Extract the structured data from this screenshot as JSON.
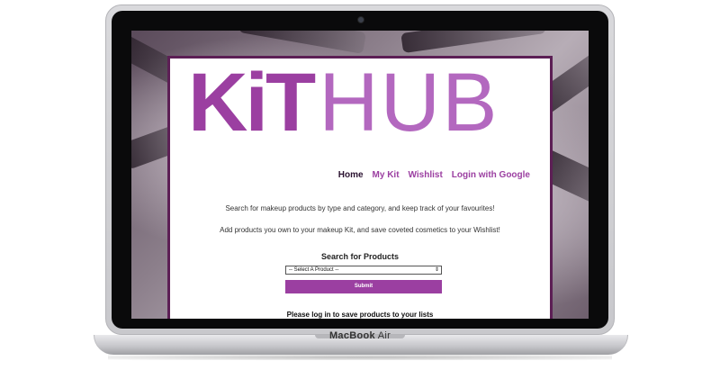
{
  "device": {
    "brand": "MacBook",
    "model": "Air"
  },
  "logo": {
    "part1": "KiT",
    "part2": "HUB"
  },
  "nav": {
    "home": "Home",
    "my_kit": "My Kit",
    "wishlist": "Wishlist",
    "login": "Login with Google"
  },
  "intro": {
    "line1": "Search for makeup products by type and category, and keep track of your favourites!",
    "line2": "Add products you own to your makeup Kit, and save coveted cosmetics to your Wishlist!"
  },
  "search": {
    "heading": "Search for Products",
    "select_value": "-- Select A Product --",
    "submit_label": "Submit"
  },
  "login_note": "Please log in to save products to your lists",
  "colors": {
    "accent": "#9b3fa1",
    "card_border": "#5c1f55"
  }
}
